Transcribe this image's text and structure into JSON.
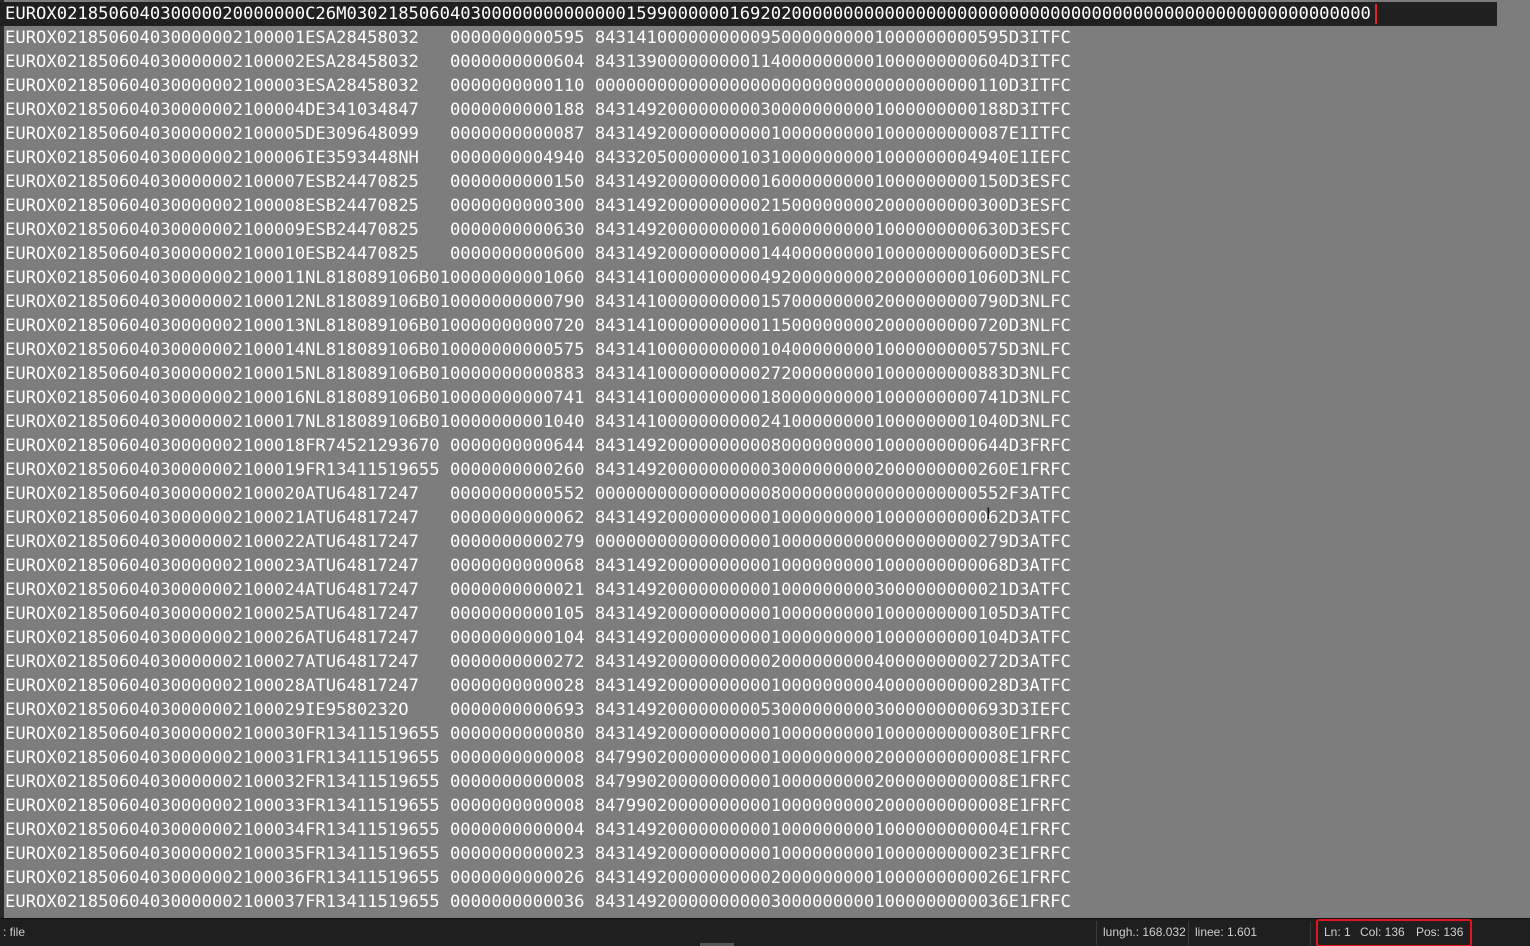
{
  "editor": {
    "lines": [
      "EUROX021850604030000020000000C26M030218506040300000000000000159900000016920200000000000000000000000000000000000000000000000000000000",
      "EUROX021850604030000002100001ESA28458032   0000000000595 8431410000000000950000000001000000000595D3ITFC",
      "EUROX021850604030000002100002ESA28458032   0000000000604 8431390000000001140000000001000000000604D3ITFC",
      "EUROX021850604030000002100003ESA28458032   0000000000110 0000000000000000000000000000000000000110D3ITFC",
      "EUROX021850604030000002100004DE341034847   0000000000188 8431492000000000300000000001000000000188D3ITFC",
      "EUROX021850604030000002100005DE309648099   0000000000087 8431492000000000010000000001000000000087E1ITFC",
      "EUROX021850604030000002100006IE3593448NH   0000000004940 8433205000000010310000000001000000004940E1IEFC",
      "EUROX021850604030000002100007ESB24470825   0000000000150 8431492000000000160000000001000000000150D3ESFC",
      "EUROX021850604030000002100008ESB24470825   0000000000300 8431492000000000215000000002000000000300D3ESFC",
      "EUROX021850604030000002100009ESB24470825   0000000000630 8431492000000000160000000001000000000630D3ESFC",
      "EUROX021850604030000002100010ESB24470825   0000000000600 8431492000000000144000000001000000000600D3ESFC",
      "EUROX021850604030000002100011NL818089106B010000000001060 8431410000000000492000000002000000001060D3NLFC",
      "EUROX021850604030000002100012NL818089106B010000000000790 8431410000000000157000000002000000000790D3NLFC",
      "EUROX021850604030000002100013NL818089106B010000000000720 8431410000000000115000000002000000000720D3NLFC",
      "EUROX021850604030000002100014NL818089106B010000000000575 8431410000000000104000000001000000000575D3NLFC",
      "EUROX021850604030000002100015NL818089106B010000000000883 8431410000000000272000000001000000000883D3NLFC",
      "EUROX021850604030000002100016NL818089106B010000000000741 8431410000000000180000000001000000000741D3NLFC",
      "EUROX021850604030000002100017NL818089106B010000000001040 8431410000000000241000000001000000001040D3NLFC",
      "EUROX021850604030000002100018FR74521293670 0000000000644 8431492000000000080000000001000000000644D3FRFC",
      "EUROX021850604030000002100019FR13411519655 0000000000260 8431492000000000030000000002000000000260E1FRFC",
      "EUROX021850604030000002100020ATU64817247   0000000000552 0000000000000000080000000000000000000552F3ATFC",
      "EUROX021850604030000002100021ATU64817247   0000000000062 8431492000000000010000000001000000000062D3ATFC",
      "EUROX021850604030000002100022ATU64817247   0000000000279 0000000000000000010000000000000000000279D3ATFC",
      "EUROX021850604030000002100023ATU64817247   0000000000068 8431492000000000010000000001000000000068D3ATFC",
      "EUROX021850604030000002100024ATU64817247   0000000000021 8431492000000000010000000003000000000021D3ATFC",
      "EUROX021850604030000002100025ATU64817247   0000000000105 8431492000000000010000000001000000000105D3ATFC",
      "EUROX021850604030000002100026ATU64817247   0000000000104 8431492000000000010000000001000000000104D3ATFC",
      "EUROX021850604030000002100027ATU64817247   0000000000272 8431492000000000020000000004000000000272D3ATFC",
      "EUROX021850604030000002100028ATU64817247   0000000000028 8431492000000000010000000004000000000028D3ATFC",
      "EUROX021850604030000002100029IE9580232O    0000000000693 8431492000000000530000000003000000000693D3IEFC",
      "EUROX021850604030000002100030FR13411519655 0000000000080 8431492000000000010000000001000000000080E1FRFC",
      "EUROX021850604030000002100031FR13411519655 0000000000008 8479902000000000010000000002000000000008E1FRFC",
      "EUROX021850604030000002100032FR13411519655 0000000000008 8479902000000000010000000002000000000008E1FRFC",
      "EUROX021850604030000002100033FR13411519655 0000000000008 8479902000000000010000000002000000000008E1FRFC",
      "EUROX021850604030000002100034FR13411519655 0000000000004 8431492000000000010000000001000000000004E1FRFC",
      "EUROX021850604030000002100035FR13411519655 0000000000023 8431492000000000010000000001000000000023E1FRFC",
      "EUROX021850604030000002100036FR13411519655 0000000000026 8431492000000000020000000001000000000026E1FRFC",
      "EUROX021850604030000002100037FR13411519655 0000000000036 8431492000000000030000000001000000000036E1FRFC"
    ]
  },
  "status": {
    "file_type": ": file",
    "length": "lungh.: 168.032",
    "lines": "linee: 1.601",
    "ln": "Ln: 1",
    "col": "Col: 136",
    "pos": "Pos: 136"
  },
  "colors": {
    "editor_bg": "#7d7d7d",
    "current_line_bg": "#202020",
    "caret": "#e0242a",
    "highlight_box": "#e3141c"
  },
  "icons": {
    "mouse_cursor": "text-ibeam-cursor"
  }
}
